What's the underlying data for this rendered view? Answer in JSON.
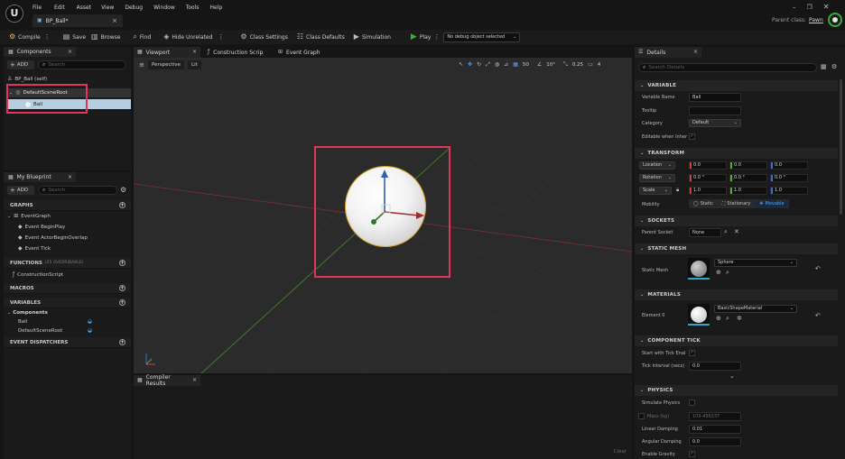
{
  "menu": {
    "items": [
      "File",
      "Edit",
      "Asset",
      "View",
      "Debug",
      "Window",
      "Tools",
      "Help"
    ]
  },
  "tab": {
    "title": "BP_Ball*"
  },
  "parent_class": {
    "label": "Parent class:",
    "value": "Pawn"
  },
  "toolbar": {
    "compile": "Compile",
    "save": "Save",
    "browse": "Browse",
    "find": "Find",
    "hide_unrelated": "Hide Unrelated",
    "class_settings": "Class Settings",
    "class_defaults": "Class Defaults",
    "simulation": "Simulation",
    "play": "Play",
    "debug_object": "No debug object selected"
  },
  "components": {
    "title": "Components",
    "add": "ADD",
    "search_placeholder": "Search",
    "self": "BP_Ball (self)",
    "root": "DefaultSceneRoot",
    "child": "Ball"
  },
  "myblueprint": {
    "title": "My Blueprint",
    "add": "ADD",
    "search_placeholder": "Search",
    "graphs": "GRAPHS",
    "event_graph": "EventGraph",
    "events": [
      "Event BeginPlay",
      "Event ActorBeginOverlap",
      "Event Tick"
    ],
    "functions": "FUNCTIONS",
    "functions_note": "(25 OVERRIDABLE)",
    "construction": "ConstructionScript",
    "macros": "MACROS",
    "variables": "VARIABLES",
    "var_group": "Components",
    "vars": [
      "Ball",
      "DefaultSceneRoot"
    ],
    "dispatchers": "EVENT DISPATCHERS"
  },
  "center_tabs": {
    "viewport": "Viewport",
    "construction": "Construction Scrip",
    "event_graph": "Event Graph"
  },
  "viewport": {
    "perspective": "Perspective",
    "lit": "Lit",
    "grid": "50",
    "angle": "10°",
    "scale": "0.25",
    "cam": "4"
  },
  "compiler": {
    "title": "Compiler Results",
    "clear": "Clear"
  },
  "details": {
    "title": "Details",
    "search_placeholder": "Search Details",
    "variable": {
      "header": "VARIABLE",
      "name_label": "Variable Name",
      "name_value": "Ball",
      "tooltip_label": "Tooltip",
      "category_label": "Category",
      "category_value": "Default",
      "editable_label": "Editable when Inher"
    },
    "transform": {
      "header": "TRANSFORM",
      "location": "Location",
      "rotation": "Rotation",
      "scale": "Scale",
      "loc": [
        "0.0",
        "0.0",
        "0.0"
      ],
      "rot": [
        "0.0 °",
        "0.0 °",
        "0.0 °"
      ],
      "scl": [
        "1.0",
        "1.0",
        "1.0"
      ],
      "mobility_label": "Mobility",
      "static": "Static",
      "stationary": "Stationary",
      "movable": "Movable"
    },
    "sockets": {
      "header": "SOCKETS",
      "parent_label": "Parent Socket",
      "parent_value": "None"
    },
    "static_mesh": {
      "header": "STATIC MESH",
      "label": "Static Mesh",
      "value": "Sphere"
    },
    "materials": {
      "header": "MATERIALS",
      "label": "Element 0",
      "value": "BasicShapeMaterial"
    },
    "tick": {
      "header": "COMPONENT TICK",
      "start_label": "Start with Tick Enal",
      "interval_label": "Tick Interval (secs)",
      "interval_value": "0.0"
    },
    "physics": {
      "header": "PHYSICS",
      "simulate_label": "Simulate Physics",
      "mass_label": "Mass (kg)",
      "mass_value": "109.456337",
      "linear_label": "Linear Damping",
      "linear_value": "0.01",
      "angular_label": "Angular Damping",
      "angular_value": "0.0",
      "gravity_label": "Enable Gravity"
    }
  },
  "colors": {
    "highlight": "#e5345c",
    "accent": "#4aa3ff",
    "selection": "#b7cde0",
    "play": "#3fae3f"
  }
}
